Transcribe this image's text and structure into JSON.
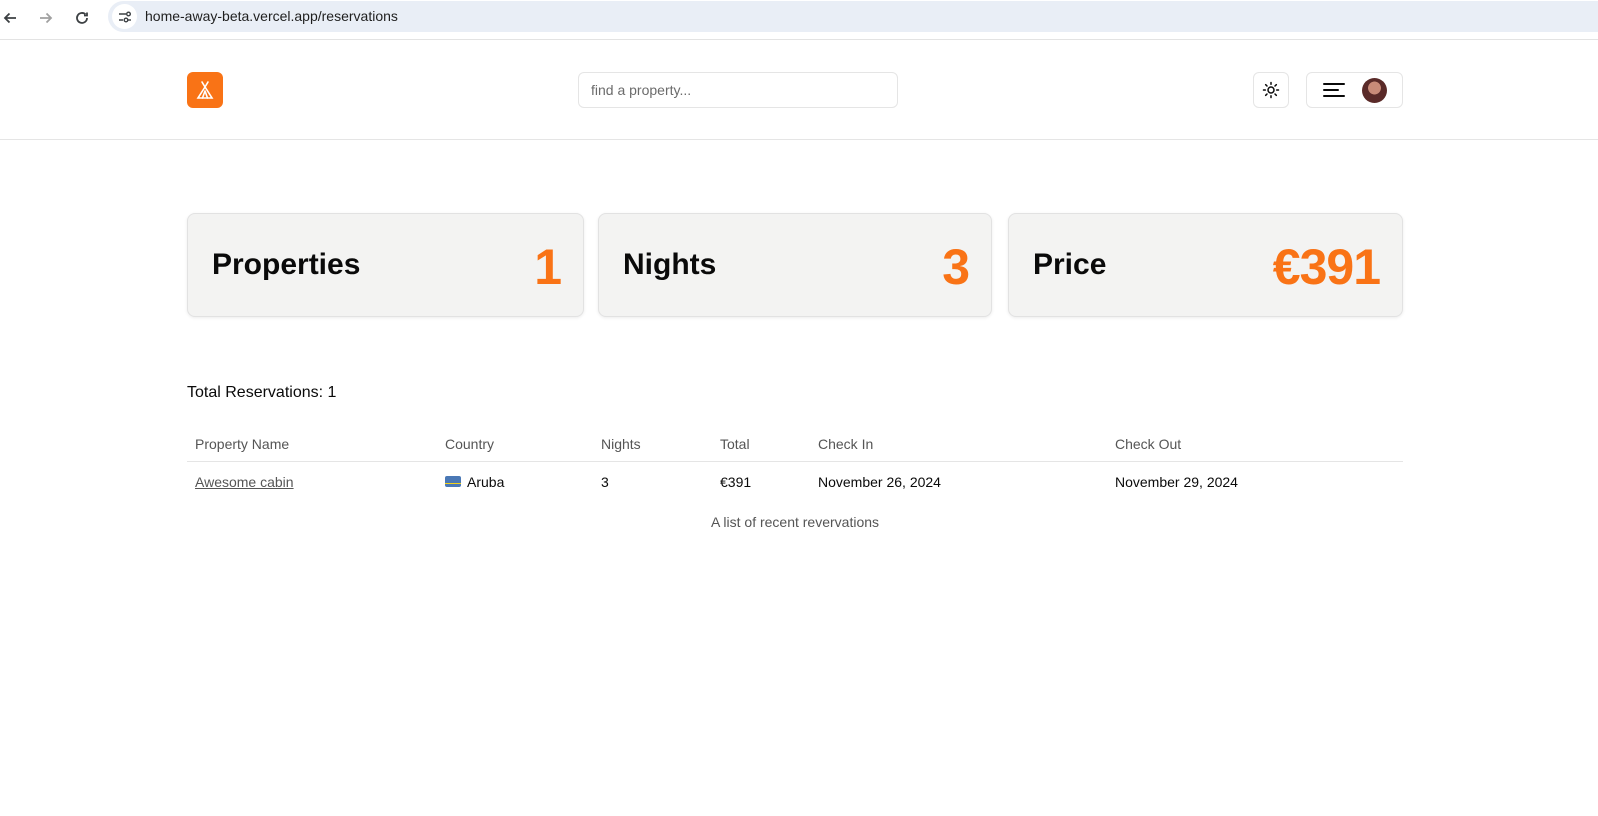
{
  "browser": {
    "url": "home-away-beta.vercel.app/reservations"
  },
  "header": {
    "search_placeholder": "find a property..."
  },
  "stats": [
    {
      "label": "Properties",
      "value": "1"
    },
    {
      "label": "Nights",
      "value": "3"
    },
    {
      "label": "Price",
      "value": "€391"
    }
  ],
  "reservations": {
    "total_text": "Total Reservations: 1",
    "columns": [
      "Property Name",
      "Country",
      "Nights",
      "Total",
      "Check In",
      "Check Out"
    ],
    "rows": [
      {
        "property": "Awesome cabin",
        "country": "Aruba",
        "nights": "3",
        "total": "€391",
        "check_in": "November 26, 2024",
        "check_out": "November 29, 2024"
      }
    ],
    "caption": "A list of recent revervations"
  },
  "colors": {
    "accent": "#f97316",
    "card_bg": "#f3f3f2"
  },
  "icons": [
    "back-arrow-icon",
    "forward-arrow-icon",
    "reload-icon",
    "site-info-icon",
    "tent-logo-icon",
    "sun-icon",
    "menu-icon"
  ]
}
